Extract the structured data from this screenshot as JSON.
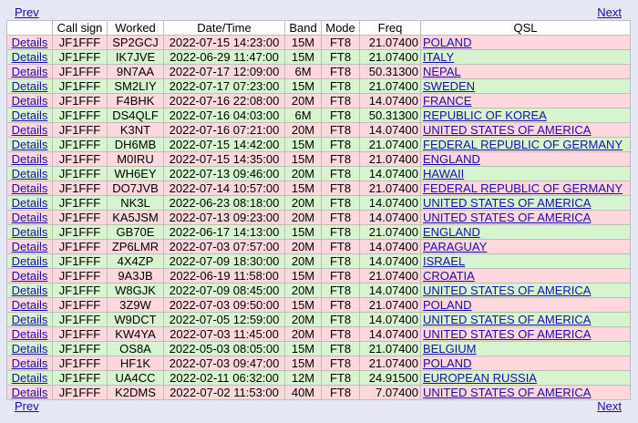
{
  "nav": {
    "prev_label": "Prev",
    "next_label": "Next"
  },
  "table": {
    "headers": [
      "",
      "Call sign",
      "Worked",
      "Date/Time",
      "Band",
      "Mode",
      "Freq",
      "QSL"
    ],
    "row_colors": {
      "pink": "#ffd7dc",
      "green": "#d6f5cf"
    },
    "rows": [
      {
        "details": "Details",
        "call": "JF1FFF",
        "worked": "SP2GCJ",
        "datetime": "2022-07-15 14:23:00",
        "band": "15M",
        "mode": "FT8",
        "freq": "21.07400",
        "qsl": "POLAND",
        "color": "pink"
      },
      {
        "details": "Details",
        "call": "JF1FFF",
        "worked": "IK7JVE",
        "datetime": "2022-06-29 11:47:00",
        "band": "15M",
        "mode": "FT8",
        "freq": "21.07400",
        "qsl": "ITALY",
        "color": "green"
      },
      {
        "details": "Details",
        "call": "JF1FFF",
        "worked": "9N7AA",
        "datetime": "2022-07-17 12:09:00",
        "band": "6M",
        "mode": "FT8",
        "freq": "50.31300",
        "qsl": "NEPAL",
        "color": "pink"
      },
      {
        "details": "Details",
        "call": "JF1FFF",
        "worked": "SM2LIY",
        "datetime": "2022-07-17 07:23:00",
        "band": "15M",
        "mode": "FT8",
        "freq": "21.07400",
        "qsl": "SWEDEN",
        "color": "green"
      },
      {
        "details": "Details",
        "call": "JF1FFF",
        "worked": "F4BHK",
        "datetime": "2022-07-16 22:08:00",
        "band": "20M",
        "mode": "FT8",
        "freq": "14.07400",
        "qsl": "FRANCE",
        "color": "pink"
      },
      {
        "details": "Details",
        "call": "JF1FFF",
        "worked": "DS4QLF",
        "datetime": "2022-07-16 04:03:00",
        "band": "6M",
        "mode": "FT8",
        "freq": "50.31300",
        "qsl": "REPUBLIC OF KOREA",
        "color": "green"
      },
      {
        "details": "Details",
        "call": "JF1FFF",
        "worked": "K3NT",
        "datetime": "2022-07-16 07:21:00",
        "band": "20M",
        "mode": "FT8",
        "freq": "14.07400",
        "qsl": "UNITED STATES OF AMERICA",
        "color": "pink"
      },
      {
        "details": "Details",
        "call": "JF1FFF",
        "worked": "DH6MB",
        "datetime": "2022-07-15 14:42:00",
        "band": "15M",
        "mode": "FT8",
        "freq": "21.07400",
        "qsl": "FEDERAL REPUBLIC OF GERMANY",
        "color": "green"
      },
      {
        "details": "Details",
        "call": "JF1FFF",
        "worked": "M0IRU",
        "datetime": "2022-07-15 14:35:00",
        "band": "15M",
        "mode": "FT8",
        "freq": "21.07400",
        "qsl": "ENGLAND",
        "color": "pink"
      },
      {
        "details": "Details",
        "call": "JF1FFF",
        "worked": "WH6EY",
        "datetime": "2022-07-13 09:46:00",
        "band": "20M",
        "mode": "FT8",
        "freq": "14.07400",
        "qsl": "HAWAII",
        "color": "green"
      },
      {
        "details": "Details",
        "call": "JF1FFF",
        "worked": "DO7JVB",
        "datetime": "2022-07-14 10:57:00",
        "band": "15M",
        "mode": "FT8",
        "freq": "21.07400",
        "qsl": "FEDERAL REPUBLIC OF GERMANY",
        "color": "pink"
      },
      {
        "details": "Details",
        "call": "JF1FFF",
        "worked": "NK3L",
        "datetime": "2022-06-23 08:18:00",
        "band": "20M",
        "mode": "FT8",
        "freq": "14.07400",
        "qsl": "UNITED STATES OF AMERICA",
        "color": "green"
      },
      {
        "details": "Details",
        "call": "JF1FFF",
        "worked": "KA5JSM",
        "datetime": "2022-07-13 09:23:00",
        "band": "20M",
        "mode": "FT8",
        "freq": "14.07400",
        "qsl": "UNITED STATES OF AMERICA",
        "color": "pink"
      },
      {
        "details": "Details",
        "call": "JF1FFF",
        "worked": "GB70E",
        "datetime": "2022-06-17 14:13:00",
        "band": "15M",
        "mode": "FT8",
        "freq": "21.07400",
        "qsl": "ENGLAND",
        "color": "green"
      },
      {
        "details": "Details",
        "call": "JF1FFF",
        "worked": "ZP6LMR",
        "datetime": "2022-07-03 07:57:00",
        "band": "20M",
        "mode": "FT8",
        "freq": "14.07400",
        "qsl": "PARAGUAY",
        "color": "pink"
      },
      {
        "details": "Details",
        "call": "JF1FFF",
        "worked": "4X4ZP",
        "datetime": "2022-07-09 18:30:00",
        "band": "20M",
        "mode": "FT8",
        "freq": "14.07400",
        "qsl": "ISRAEL",
        "color": "green"
      },
      {
        "details": "Details",
        "call": "JF1FFF",
        "worked": "9A3JB",
        "datetime": "2022-06-19 11:58:00",
        "band": "15M",
        "mode": "FT8",
        "freq": "21.07400",
        "qsl": "CROATIA",
        "color": "pink"
      },
      {
        "details": "Details",
        "call": "JF1FFF",
        "worked": "W8GJK",
        "datetime": "2022-07-09 08:45:00",
        "band": "20M",
        "mode": "FT8",
        "freq": "14.07400",
        "qsl": "UNITED STATES OF AMERICA",
        "color": "green"
      },
      {
        "details": "Details",
        "call": "JF1FFF",
        "worked": "3Z9W",
        "datetime": "2022-07-03 09:50:00",
        "band": "15M",
        "mode": "FT8",
        "freq": "21.07400",
        "qsl": "POLAND",
        "color": "pink"
      },
      {
        "details": "Details",
        "call": "JF1FFF",
        "worked": "W9DCT",
        "datetime": "2022-07-05 12:59:00",
        "band": "20M",
        "mode": "FT8",
        "freq": "14.07400",
        "qsl": "UNITED STATES OF AMERICA",
        "color": "green"
      },
      {
        "details": "Details",
        "call": "JF1FFF",
        "worked": "KW4YA",
        "datetime": "2022-07-03 11:45:00",
        "band": "20M",
        "mode": "FT8",
        "freq": "14.07400",
        "qsl": "UNITED STATES OF AMERICA",
        "color": "pink"
      },
      {
        "details": "Details",
        "call": "JF1FFF",
        "worked": "OS8A",
        "datetime": "2022-05-03 08:05:00",
        "band": "15M",
        "mode": "FT8",
        "freq": "21.07400",
        "qsl": "BELGIUM",
        "color": "green"
      },
      {
        "details": "Details",
        "call": "JF1FFF",
        "worked": "HF1K",
        "datetime": "2022-07-03 09:47:00",
        "band": "15M",
        "mode": "FT8",
        "freq": "21.07400",
        "qsl": "POLAND",
        "color": "pink"
      },
      {
        "details": "Details",
        "call": "JF1FFF",
        "worked": "UA4CC",
        "datetime": "2022-02-11 06:32:00",
        "band": "12M",
        "mode": "FT8",
        "freq": "24.91500",
        "qsl": "EUROPEAN RUSSIA",
        "color": "green"
      },
      {
        "details": "Details",
        "call": "JF1FFF",
        "worked": "K2DMS",
        "datetime": "2022-07-02 11:53:00",
        "band": "40M",
        "mode": "FT8",
        "freq": "7.07400",
        "qsl": "UNITED STATES OF AMERICA",
        "color": "pink"
      }
    ]
  }
}
